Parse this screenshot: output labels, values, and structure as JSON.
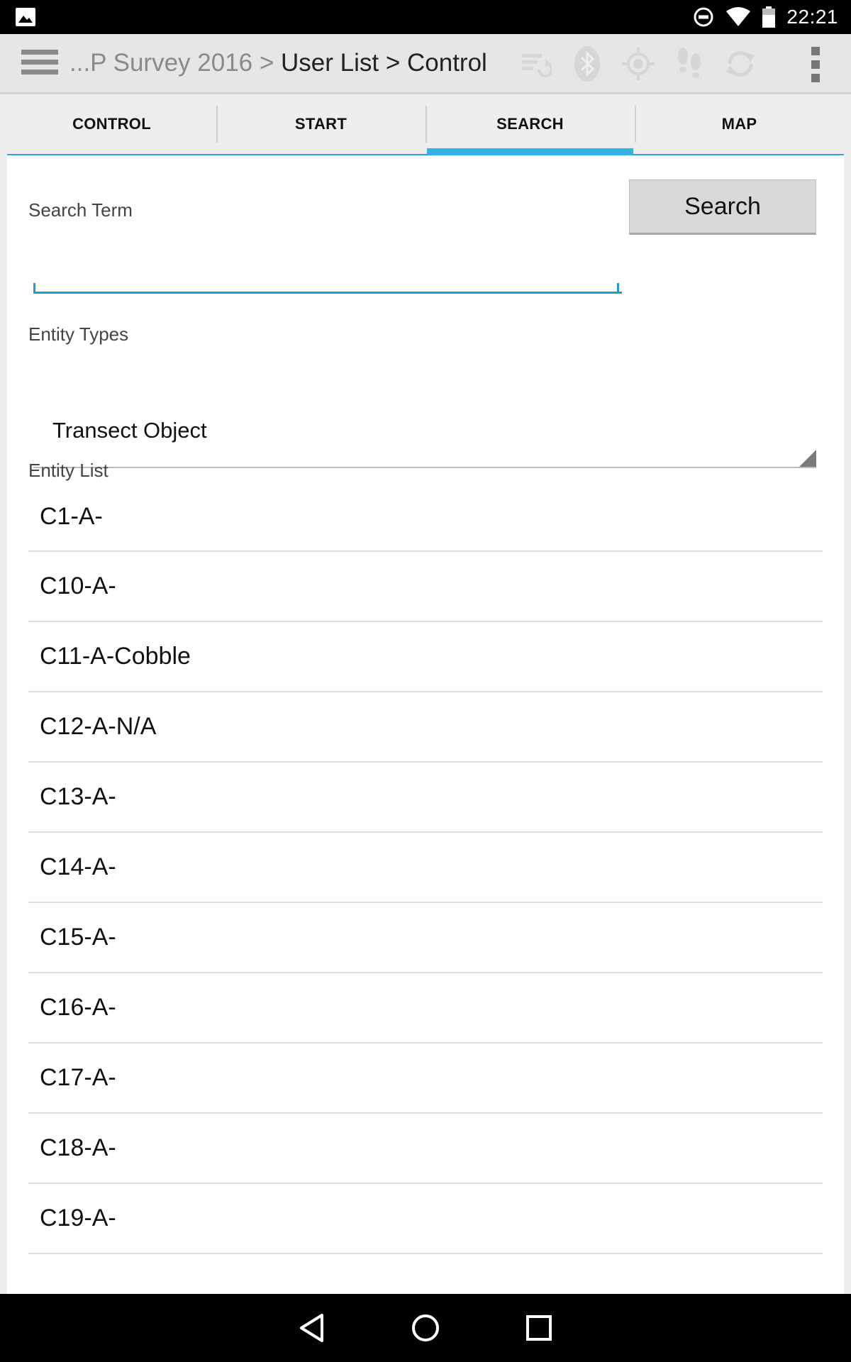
{
  "status_bar": {
    "time": "22:21",
    "icons": [
      "gallery-icon",
      "do-not-disturb-icon",
      "wifi-icon",
      "battery-icon"
    ]
  },
  "action_bar": {
    "breadcrumb_prefix": "...P Survey 2016 > ",
    "breadcrumb_current": "User List > Control",
    "icons": [
      "sync-list-icon",
      "bluetooth-icon",
      "gps-icon",
      "tracking-footsteps-icon",
      "refresh-icon",
      "overflow-menu-icon"
    ]
  },
  "tabs": [
    {
      "label": "CONTROL",
      "active": false
    },
    {
      "label": "START",
      "active": false
    },
    {
      "label": "SEARCH",
      "active": true
    },
    {
      "label": "MAP",
      "active": false
    }
  ],
  "search": {
    "label": "Search Term",
    "value": "",
    "button_label": "Search"
  },
  "entity_types": {
    "label": "Entity Types",
    "selected": "Transect Object"
  },
  "entity_list": {
    "label": "Entity List",
    "items": [
      "C1-A-",
      "C10-A-",
      "C11-A-Cobble",
      "C12-A-N/A",
      "C13-A-",
      "C14-A-",
      "C15-A-",
      "C16-A-",
      "C17-A-",
      "C18-A-",
      "C19-A-"
    ]
  },
  "colors": {
    "accent": "#35b1e3",
    "focus_underline": "#2399cc",
    "action_bar_bg": "#e6e6e6",
    "content_bg": "#ffffff"
  }
}
